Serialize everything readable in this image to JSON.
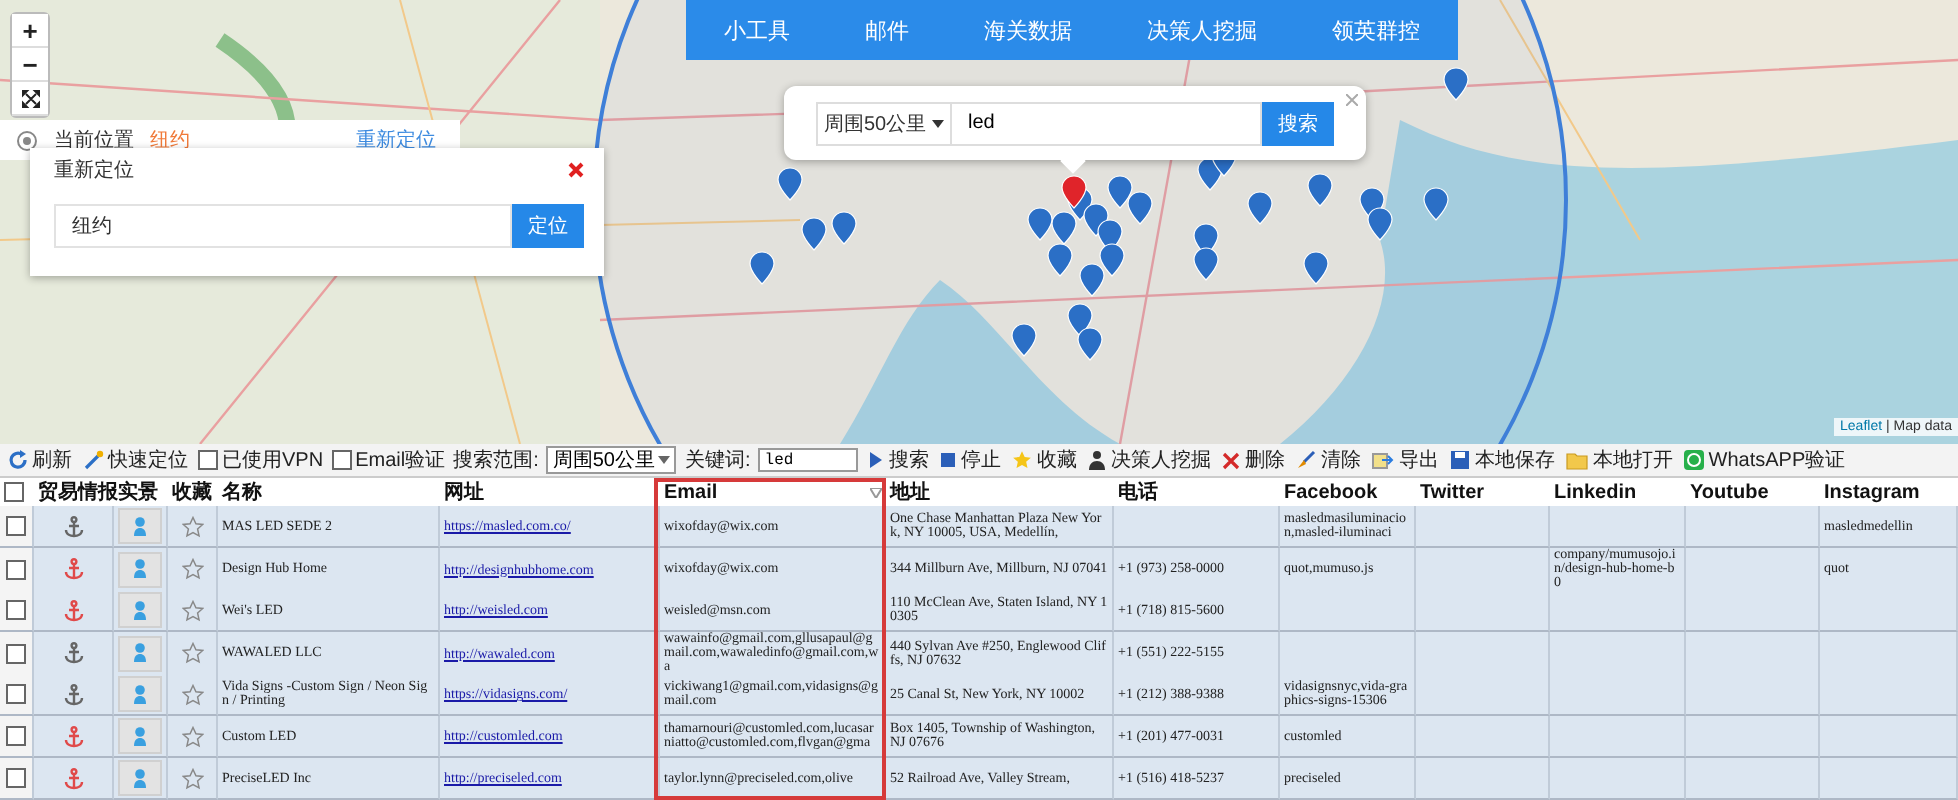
{
  "map": {
    "zoom_controls": [
      "+",
      "−"
    ],
    "location": {
      "label": "当前位置",
      "city": "纽约",
      "action": "重新定位"
    },
    "relocate_dialog": {
      "title": "重新定位",
      "value": "纽约",
      "button": "定位"
    },
    "nav": [
      "小工具",
      "邮件",
      "海关数据",
      "决策人挖掘",
      "领英群控"
    ],
    "search_popup": {
      "range": "周围50公里",
      "keyword": "led",
      "button": "搜索"
    },
    "attribution": {
      "link": "Leaflet",
      "text": "| Map data"
    }
  },
  "toolbar": {
    "refresh": "刷新",
    "locate": "快速定位",
    "vpn": {
      "label": "已使用VPN",
      "checked": false
    },
    "email_verify": {
      "label": "Email验证",
      "checked": false
    },
    "range": {
      "label": "搜索范围:",
      "value": "周围50公里"
    },
    "keyword": {
      "label": "关键词:",
      "value": "led"
    },
    "actions": [
      "搜索",
      "停止",
      "收藏",
      "决策人挖掘",
      "删除",
      "清除",
      "导出",
      "本地保存",
      "本地打开",
      "WhatsAPP验证"
    ]
  },
  "table": {
    "header_checked": false,
    "columns": [
      "贸易情报",
      "实景",
      "收藏",
      "名称",
      "网址",
      "Email",
      "地址",
      "电话",
      "Facebook",
      "Twitter",
      "Linkedin",
      "Youtube",
      "Instagram"
    ],
    "rows": [
      {
        "checked": false,
        "anchor_alert": false,
        "favorite": false,
        "name": "MAS LED SEDE 2",
        "url": "https://masled.com.co/",
        "email": "wixofday@wix.com",
        "address": "One Chase Manhattan Plaza New York, NY 10005, USA, Medellín,",
        "facebook": "masledmasiluminacion,masled-iluminaci",
        "instagram": "masledmedellin"
      },
      {
        "checked": false,
        "anchor_alert": true,
        "favorite": false,
        "name": "Design Hub Home",
        "url": "http://designhubhome.com",
        "email": "wixofday@wix.com",
        "address": "344 Millburn Ave, Millburn, NJ 07041",
        "phone": "+1 (973) 258-0000",
        "facebook": "quot,mumuso.js",
        "linkedin": "company/mumusojo.in/design-hub-home-b0",
        "instagram": "quot"
      },
      {
        "checked": false,
        "anchor_alert": true,
        "favorite": false,
        "name": "Wei's LED",
        "url": "http://weisled.com",
        "email": "weisled@msn.com",
        "address": "110 McClean Ave, Staten Island, NY 10305",
        "phone": "+1 (718) 815-5600"
      },
      {
        "checked": false,
        "anchor_alert": false,
        "favorite": false,
        "name": "WAWALED LLC",
        "url": "http://wawaled.com",
        "email": "wawainfo@gmail.com,gllusapaul@gmail.com,wawaledinfo@gmail.com,wa",
        "address": "440 Sylvan Ave #250, Englewood Cliffs, NJ 07632",
        "phone": "+1 (551) 222-5155"
      },
      {
        "checked": false,
        "anchor_alert": false,
        "favorite": false,
        "name": "Vida Signs -Custom Sign / Neon Sign / Printing",
        "url": "https://vidasigns.com/",
        "email": "vickiwang1@gmail.com,vidasigns@gmail.com",
        "address": "25 Canal St, New York, NY 10002",
        "phone": "+1 (212) 388-9388",
        "facebook": "vidasignsnyc,vida-graphics-signs-15306"
      },
      {
        "checked": false,
        "anchor_alert": true,
        "favorite": false,
        "name": "Custom LED",
        "url": "http://customled.com",
        "email": "thamarnouri@customled.com,lucasarniatto@customled.com,flvgan@gma",
        "address": "Box 1405, Township of Washington, NJ 07676",
        "phone": "+1 (201) 477-0031",
        "facebook": "customled"
      },
      {
        "checked": false,
        "anchor_alert": true,
        "favorite": false,
        "name": "PreciseLED Inc",
        "url": "http://preciseled.com",
        "email": "taylor.lynn@preciseled.com,olive",
        "address": "52 Railroad Ave, Valley Stream,",
        "phone": "+1 (516) 418-5237",
        "facebook": "preciseled"
      }
    ]
  }
}
